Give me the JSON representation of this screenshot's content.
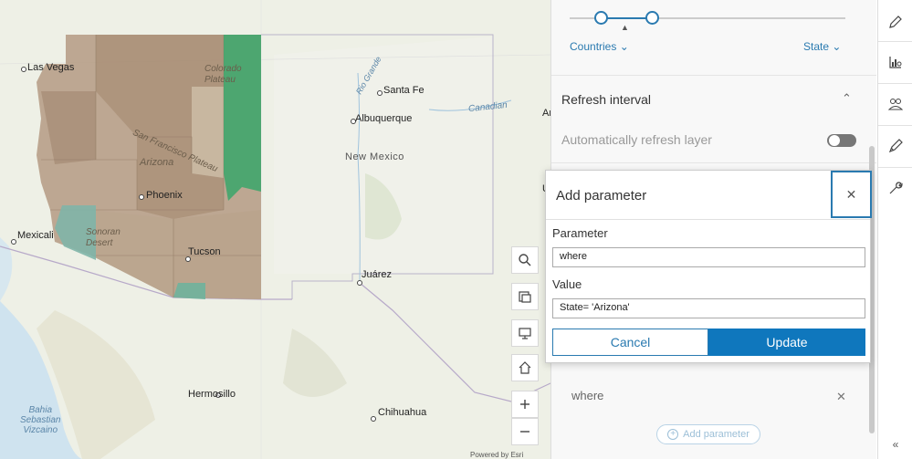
{
  "map": {
    "cities": {
      "las_vegas": "Las Vegas",
      "santa_fe": "Santa Fe",
      "albuquerque": "Albuquerque",
      "phoenix": "Phoenix",
      "tucson": "Tucson",
      "mexicali": "Mexicali",
      "juarez": "Juárez",
      "hermosillo": "Hermosillo",
      "chihuahua": "Chihuahua"
    },
    "regions": {
      "colorado_plateau": "Colorado\nPlateau",
      "san_francisco_plateau": "San Francisco Plateau",
      "arizona": "Arizona",
      "sonoran_desert": "Sonoran\nDesert",
      "new_mexico": "New Mexico",
      "bahia": "Bahia\nSebastian\nVizcaino"
    },
    "water": {
      "rio_grande": "Rio Grande",
      "canadian": "Canadian"
    },
    "partial_labels": {
      "am": "Am",
      "u": "U"
    },
    "attribution": "Powered by Esri",
    "colors": {
      "county_fill": "#b49a82",
      "highlight_green": "#4fae7a",
      "teal": "#7fb5a8"
    }
  },
  "panel": {
    "slider_left_link": "Countries",
    "slider_right_link": "State",
    "refresh_section_title": "Refresh interval",
    "auto_refresh_label": "Automatically refresh layer",
    "param_item": "where",
    "add_parameter": "Add parameter"
  },
  "dialog": {
    "title": "Add parameter",
    "parameter_label": "Parameter",
    "parameter_value": "where",
    "value_label": "Value",
    "value_value": "State= 'Arizona'",
    "cancel": "Cancel",
    "update": "Update"
  },
  "colors": {
    "accent": "#0f77bd"
  }
}
